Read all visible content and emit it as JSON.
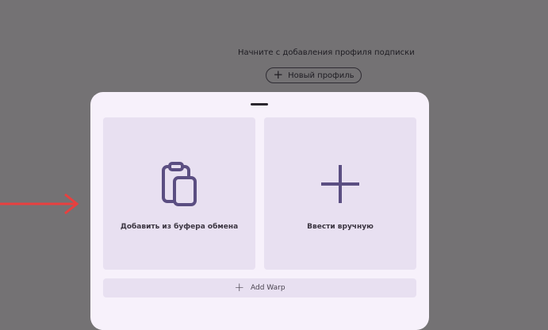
{
  "background": {
    "message": "Начните с добавления профиля подписки",
    "new_profile_button": "Новый профиль",
    "new_profile_icon": "plus-icon"
  },
  "sheet": {
    "options": [
      {
        "label": "Добавить из буфера обмена",
        "icon": "clipboard-icon"
      },
      {
        "label": "Ввести вручную",
        "icon": "plus-icon"
      }
    ],
    "warp_button": "Add Warp",
    "warp_icon": "plus-icon"
  },
  "colors": {
    "scrim": "#747274",
    "sheet": "#f7f1fb",
    "card": "#e8e0f1",
    "accent": "#5b4e82",
    "annotation_arrow": "#e8403f"
  }
}
